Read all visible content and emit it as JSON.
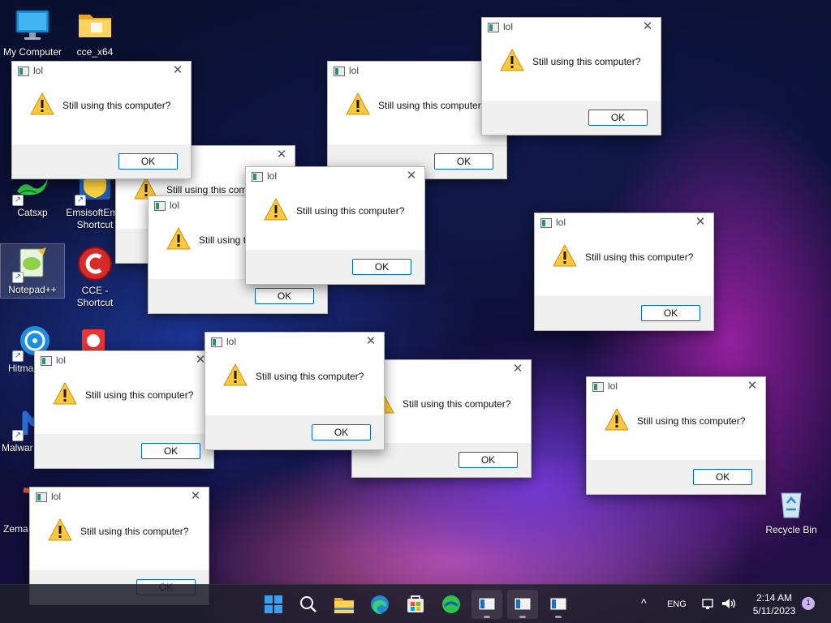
{
  "desktop": {
    "icons": [
      {
        "label": "My Computer",
        "icon": "monitor-icon"
      },
      {
        "label": "cce_x64",
        "icon": "folder-icon"
      },
      {
        "label": "Catsxp",
        "icon": "catsxp-icon"
      },
      {
        "label": "EmsisoftEm - Shortcut",
        "icon": "emsisoft-icon"
      },
      {
        "label": "Notepad++",
        "icon": "notepadpp-icon"
      },
      {
        "label": "CCE - Shortcut",
        "icon": "cce-icon"
      },
      {
        "label": "Hitma",
        "icon": "hitman-icon"
      },
      {
        "label": "Malwar",
        "icon": "malwarebytes-icon"
      },
      {
        "label": "Zema",
        "icon": "zemana-icon"
      }
    ],
    "recycle_bin": {
      "label": "Recycle Bin"
    }
  },
  "dialog": {
    "title": "lol",
    "message": "Still using this computer?",
    "ok_label": "OK",
    "close_glyph": "✕"
  },
  "taskbar": {
    "pinned": [
      "start-icon",
      "search-icon",
      "file-explorer-icon",
      "edge-icon",
      "store-icon",
      "catsxp-icon",
      "window-app-icon",
      "window-app-icon",
      "window-app-icon"
    ],
    "language": "ENG",
    "time": "2:14 AM",
    "date": "5/11/2023",
    "notification_count": "1",
    "overflow_glyph": "^"
  },
  "colors": {
    "accent": "#0067c0",
    "warning": "#ffc83d"
  }
}
